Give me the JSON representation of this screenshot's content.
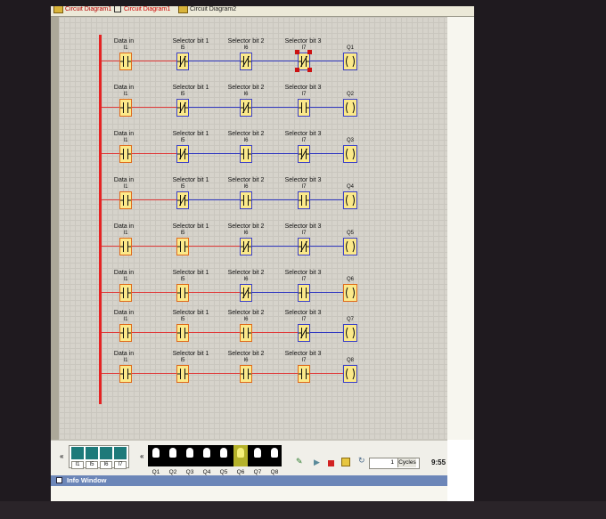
{
  "tabs": [
    {
      "label": "Circuit Diagram1"
    },
    {
      "label": "Circuit Diagram1"
    },
    {
      "label": "Circuit Diagram2"
    }
  ],
  "rows": [
    {
      "labels": [
        "Data in",
        "Selector bit 1",
        "Selector bit 2",
        "Selector bit 3"
      ],
      "subs": [
        "I1",
        "I5",
        "I6",
        "I7"
      ],
      "types": [
        "no",
        "nc",
        "nc",
        "nc"
      ],
      "output": "Q1",
      "active": false,
      "selected": 3
    },
    {
      "labels": [
        "Data in",
        "Selector bit 1",
        "Selector bit 2",
        "Selector bit 3"
      ],
      "subs": [
        "I1",
        "I5",
        "I6",
        "I7"
      ],
      "types": [
        "no",
        "nc",
        "nc",
        "no"
      ],
      "output": "Q2",
      "active": false,
      "selected": -1
    },
    {
      "labels": [
        "Data in",
        "Selector bit 1",
        "Selector bit 2",
        "Selector bit 3"
      ],
      "subs": [
        "I1",
        "I5",
        "I6",
        "I7"
      ],
      "types": [
        "no",
        "nc",
        "no",
        "nc"
      ],
      "output": "Q3",
      "active": false,
      "selected": -1
    },
    {
      "labels": [
        "Data in",
        "Selector bit 1",
        "Selector bit 2",
        "Selector bit 3"
      ],
      "subs": [
        "I1",
        "I5",
        "I6",
        "I7"
      ],
      "types": [
        "no",
        "nc",
        "no",
        "no"
      ],
      "output": "Q4",
      "active": false,
      "selected": -1
    },
    {
      "labels": [
        "Data in",
        "Selector bit 1",
        "Selector bit 2",
        "Selector bit 3"
      ],
      "subs": [
        "I1",
        "I5",
        "I6",
        "I7"
      ],
      "types": [
        "no",
        "no",
        "nc",
        "nc"
      ],
      "output": "Q5",
      "active": false,
      "selected": -1
    },
    {
      "labels": [
        "Data in",
        "Selector bit 1",
        "Selector bit 2",
        "Selector bit 3"
      ],
      "subs": [
        "I1",
        "I5",
        "I6",
        "I7"
      ],
      "types": [
        "no",
        "no",
        "nc",
        "no"
      ],
      "output": "Q6",
      "active": true,
      "selected": -1
    },
    {
      "labels": [
        "Data in",
        "Selector bit 1",
        "Selector bit 2",
        "Selector bit 3"
      ],
      "subs": [
        "I1",
        "I5",
        "I6",
        "I7"
      ],
      "types": [
        "no",
        "no",
        "no",
        "nc"
      ],
      "output": "Q7",
      "active": false,
      "selected": -1
    },
    {
      "labels": [
        "Data in",
        "Selector bit 1",
        "Selector bit 2",
        "Selector bit 3"
      ],
      "subs": [
        "I1",
        "I5",
        "I6",
        "I7"
      ],
      "types": [
        "no",
        "no",
        "no",
        "no"
      ],
      "output": "Q8",
      "active": false,
      "selected": -1
    }
  ],
  "inputs": {
    "nav_left": "«",
    "items": [
      {
        "label": "I1",
        "icon": "switch-icon"
      },
      {
        "label": "I5",
        "icon": "switch-icon"
      },
      {
        "label": "I6",
        "icon": "switch-icon"
      },
      {
        "label": "I7",
        "icon": "switch-icon"
      }
    ]
  },
  "outputs": {
    "nav_left": "«",
    "items": [
      {
        "label": "Q1",
        "lit": false
      },
      {
        "label": "Q2",
        "lit": false
      },
      {
        "label": "Q3",
        "lit": false
      },
      {
        "label": "Q4",
        "lit": false
      },
      {
        "label": "Q5",
        "lit": false
      },
      {
        "label": "Q6",
        "lit": true
      },
      {
        "label": "Q7",
        "lit": false
      },
      {
        "label": "Q8",
        "lit": false
      }
    ]
  },
  "simulation": {
    "cycles_value": "1",
    "cycles_label": "Cycles",
    "time": "9:55"
  },
  "info_window": {
    "title": "Info Window"
  },
  "colors": {
    "rail": "#e52323",
    "contact_fill": "#fbe98a",
    "active_border": "#e06a1a",
    "inactive_border": "#3a3fc8",
    "wire_active": "#e03a3a",
    "wire_inactive": "#3038c0"
  }
}
